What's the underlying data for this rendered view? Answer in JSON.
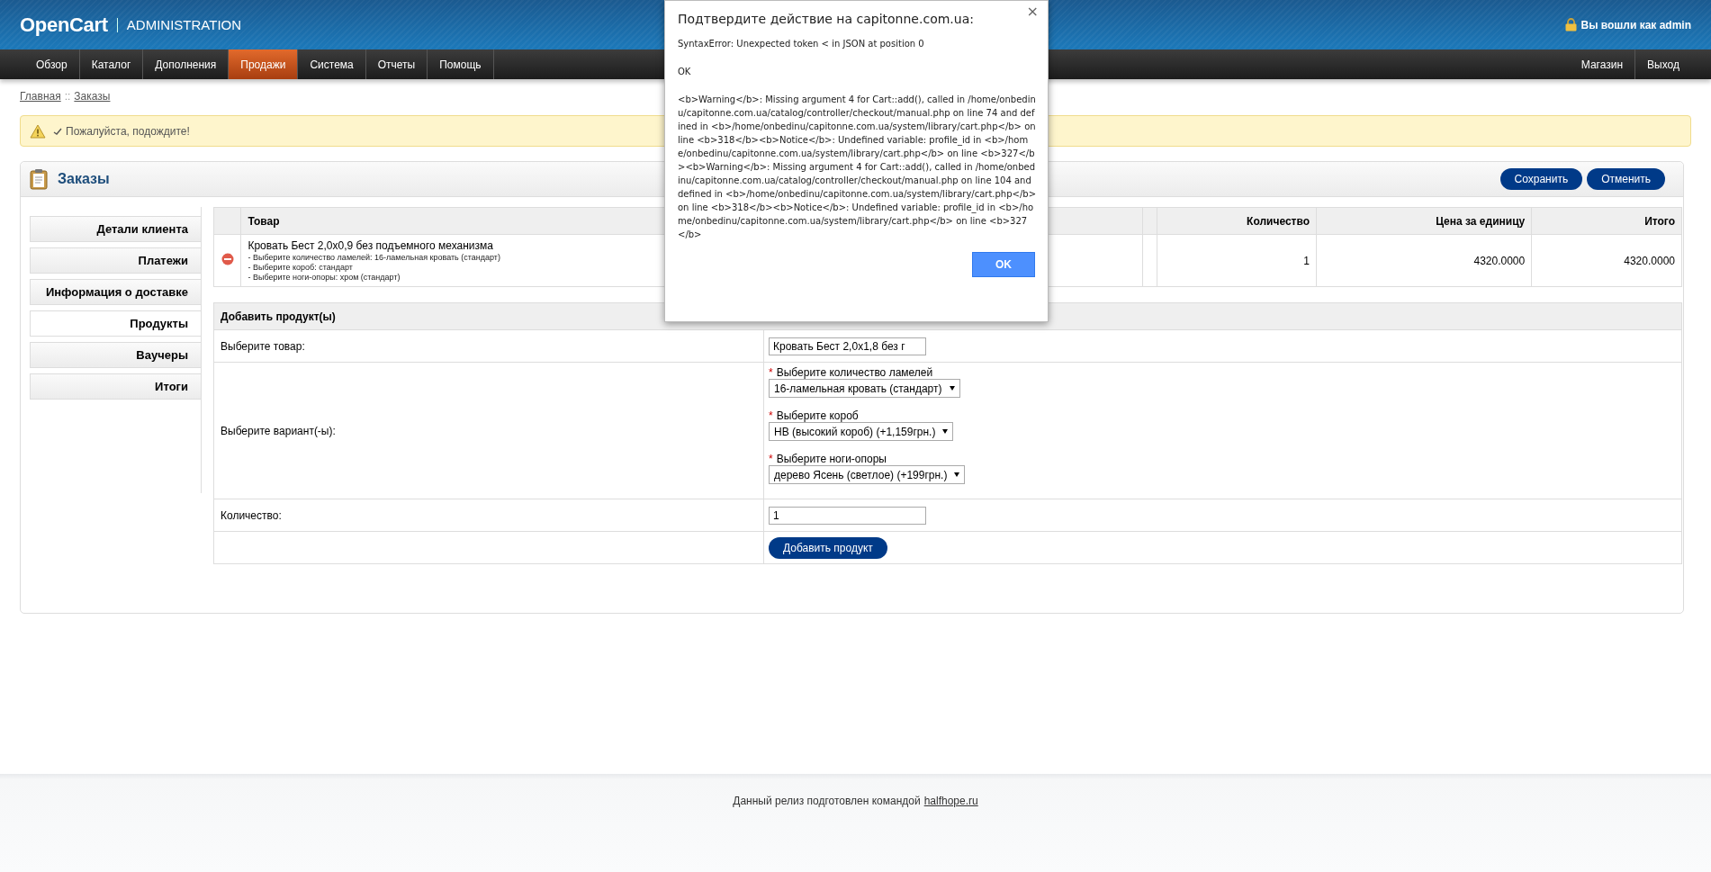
{
  "header": {
    "logo": "OpenCart",
    "subtitle": "ADMINISTRATION",
    "user": "Вы вошли как admin"
  },
  "nav": {
    "items": [
      {
        "label": "Обзор",
        "selected": false
      },
      {
        "label": "Каталог",
        "selected": false
      },
      {
        "label": "Дополнения",
        "selected": false
      },
      {
        "label": "Продажи",
        "selected": true
      },
      {
        "label": "Система",
        "selected": false
      },
      {
        "label": "Отчеты",
        "selected": false
      },
      {
        "label": "Помощь",
        "selected": false
      }
    ],
    "right_items": [
      "Магазин",
      "Выход"
    ]
  },
  "breadcrumb": {
    "items": [
      "Главная",
      "Заказы"
    ],
    "separator": "::"
  },
  "alert": {
    "text": "Пожалуйста, подождите!"
  },
  "panel": {
    "title": "Заказы",
    "buttons": [
      "Сохранить",
      "Отменить"
    ]
  },
  "tabs": [
    {
      "label": "Детали клиента",
      "selected": false
    },
    {
      "label": "Платежи",
      "selected": false
    },
    {
      "label": "Информация о доставке",
      "selected": false
    },
    {
      "label": "Продукты",
      "selected": true
    },
    {
      "label": "Ваучеры",
      "selected": false
    },
    {
      "label": "Итоги",
      "selected": false
    }
  ],
  "products_table": {
    "columns": [
      "Товар",
      "Количество",
      "Цена за единицу",
      "Итого"
    ],
    "rows": [
      {
        "name": "Кровать Бест 2,0х0,9 без подъемного механизма",
        "options": [
          "- Выберите количество ламелей: 16-ламельная кровать (стандарт)",
          "- Выберите короб: стандарт",
          "- Выберите ноги-опоры: хром (стандарт)"
        ],
        "quantity": "1",
        "price": "4320.0000",
        "total": "4320.0000"
      }
    ]
  },
  "add_product": {
    "title": "Добавить продукт(ы)",
    "rows": [
      {
        "kind": "input",
        "label": "Выберите товар:",
        "value": "Кровать Бест 2,0х1,8 без г"
      },
      {
        "kind": "options",
        "label": "Выберите вариант(-ы):",
        "selects": [
          {
            "mark": "*",
            "label": "Выберите количество ламелей",
            "value": "16-ламельная кровать (стандарт)"
          },
          {
            "mark": "*",
            "label": "Выберите короб",
            "value": "НВ (высокий короб) (+1,159грн.)"
          },
          {
            "mark": "*",
            "label": "Выберите ноги-опоры",
            "value": "дерево Ясень (светлое) (+199грн.)"
          }
        ]
      },
      {
        "kind": "input",
        "label": "Количество:",
        "value": "1"
      },
      {
        "kind": "button",
        "button": "Добавить продукт"
      }
    ]
  },
  "dialog": {
    "title": "Подтвердите действие на capitonne.com.ua:",
    "message": "SyntaxError: Unexpected token < in JSON at position 0",
    "status": "OK",
    "details": "<b>Warning</b>: Missing argument 4 for Cart::add(), called in /home/onbedinu/capitonne.com.ua/catalog/controller/checkout/manual.php on line 74 and defined in <b>/home/onbedinu/capitonne.com.ua/system/library/cart.php</b> on line <b>318</b><b>Notice</b>: Undefined variable: profile_id in <b>/home/onbedinu/capitonne.com.ua/system/library/cart.php</b> on line <b>327</b><b>Warning</b>: Missing argument 4 for Cart::add(), called in /home/onbedinu/capitonne.com.ua/catalog/controller/checkout/manual.php on line 104 and defined in <b>/home/onbedinu/capitonne.com.ua/system/library/cart.php</b> on line <b>318</b><b>Notice</b>: Undefined variable: profile_id in <b>/home/onbedinu/capitonne.com.ua/system/library/cart.php</b> on line <b>327</b>",
    "close": "×",
    "button": "OK"
  },
  "footer": {
    "text": "Данный релиз подготовлен командой",
    "link": "halfhope.ru"
  }
}
